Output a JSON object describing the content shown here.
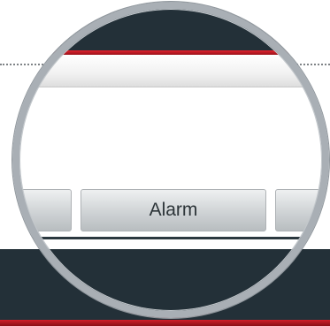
{
  "tabs": [
    {
      "label": ""
    },
    {
      "label": "Alarm"
    },
    {
      "label": ""
    }
  ],
  "colors": {
    "header_bg": "#233038",
    "accent_red": "#d0202a",
    "tab_gradient_top": "#eef0f1",
    "tab_gradient_bottom": "#b8bdc0",
    "ring": "#a9afb5"
  }
}
